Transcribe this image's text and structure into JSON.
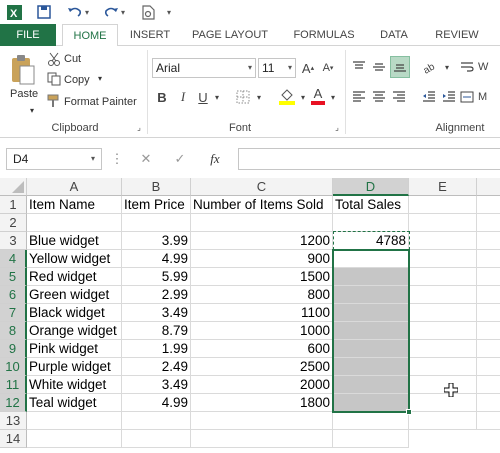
{
  "tabs": [
    "FILE",
    "HOME",
    "INSERT",
    "PAGE LAYOUT",
    "FORMULAS",
    "DATA",
    "REVIEW"
  ],
  "clipboard": {
    "paste": "Paste",
    "cut": "Cut",
    "copy": "Copy",
    "format_painter": "Format Painter",
    "group": "Clipboard"
  },
  "font": {
    "name": "Arial",
    "size": "11",
    "group": "Font",
    "bold": "B",
    "italic": "I",
    "underline": "U",
    "grow": "A",
    "shrink": "A",
    "font_color": "A"
  },
  "alignment": {
    "group": "Alignment",
    "wrap": "W",
    "merge": "M"
  },
  "formula_bar": {
    "name_box": "D4",
    "fx": "fx",
    "cancel": "✕",
    "enter": "✓",
    "value": ""
  },
  "columns": [
    "A",
    "B",
    "C",
    "D",
    "E"
  ],
  "rows": [
    "1",
    "2",
    "3",
    "4",
    "5",
    "6",
    "7",
    "8",
    "9",
    "10",
    "11",
    "12",
    "13",
    "14"
  ],
  "sheet": {
    "headers": [
      "Item Name",
      "Item Price",
      "Number of Items Sold",
      "Total Sales"
    ],
    "items": [
      {
        "name": "Blue widget",
        "price": "3.99",
        "sold": "1200",
        "total": "4788"
      },
      {
        "name": "Yellow widget",
        "price": "4.99",
        "sold": "900",
        "total": ""
      },
      {
        "name": "Red widget",
        "price": "5.99",
        "sold": "1500",
        "total": ""
      },
      {
        "name": "Green widget",
        "price": "2.99",
        "sold": "800",
        "total": ""
      },
      {
        "name": "Black widget",
        "price": "3.49",
        "sold": "1100",
        "total": ""
      },
      {
        "name": "Orange widget",
        "price": "8.79",
        "sold": "1000",
        "total": ""
      },
      {
        "name": "Pink widget",
        "price": "1.99",
        "sold": "600",
        "total": ""
      },
      {
        "name": "Purple widget",
        "price": "2.49",
        "sold": "2500",
        "total": ""
      },
      {
        "name": "White widget",
        "price": "3.49",
        "sold": "2000",
        "total": ""
      },
      {
        "name": "Teal widget",
        "price": "4.99",
        "sold": "1800",
        "total": ""
      }
    ]
  },
  "colors": {
    "accent": "#217346",
    "selection": "#c6c6c6"
  }
}
